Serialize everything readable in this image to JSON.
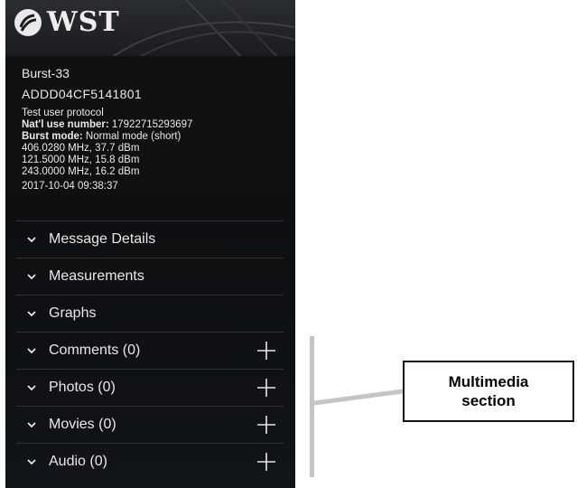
{
  "app": {
    "logo_text": "WST",
    "logo_icon": "wst-logo-icon"
  },
  "device": {
    "name": "Burst-33",
    "id": "ADDD04CF5141801",
    "protocol": "Test user protocol",
    "natl_use_label": "Nat'l use number:",
    "natl_use_value": " 17922715293697",
    "burst_mode_label": "Burst mode:",
    "burst_mode_value": " Normal mode (short)",
    "frequencies": [
      "406.0280 MHz, 37.7 dBm",
      "121.5000 MHz, 15.8 dBm",
      "243.0000 MHz, 16.2 dBm"
    ],
    "timestamp": "2017-10-04 09:38:37"
  },
  "sections": [
    {
      "label": "Message Details",
      "icon": "chevron-down-icon"
    },
    {
      "label": "Measurements",
      "icon": "chevron-down-icon"
    },
    {
      "label": "Graphs",
      "icon": "chevron-down-icon"
    },
    {
      "label": "Comments (0)",
      "icon": "chevron-down-icon",
      "add_icon": "plus-icon"
    },
    {
      "label": "Photos (0)",
      "icon": "chevron-down-icon",
      "add_icon": "plus-icon"
    },
    {
      "label": "Movies (0)",
      "icon": "chevron-down-icon",
      "add_icon": "plus-icon"
    },
    {
      "label": "Audio (0)",
      "icon": "chevron-down-icon",
      "add_icon": "plus-icon"
    }
  ],
  "annotation": {
    "line1": "Multimedia",
    "line2": "section"
  },
  "colors": {
    "panel_bg": "#0f1113",
    "text": "#e8e8e8",
    "divider": "#2e3236",
    "bracket": "#c4c4c4"
  }
}
